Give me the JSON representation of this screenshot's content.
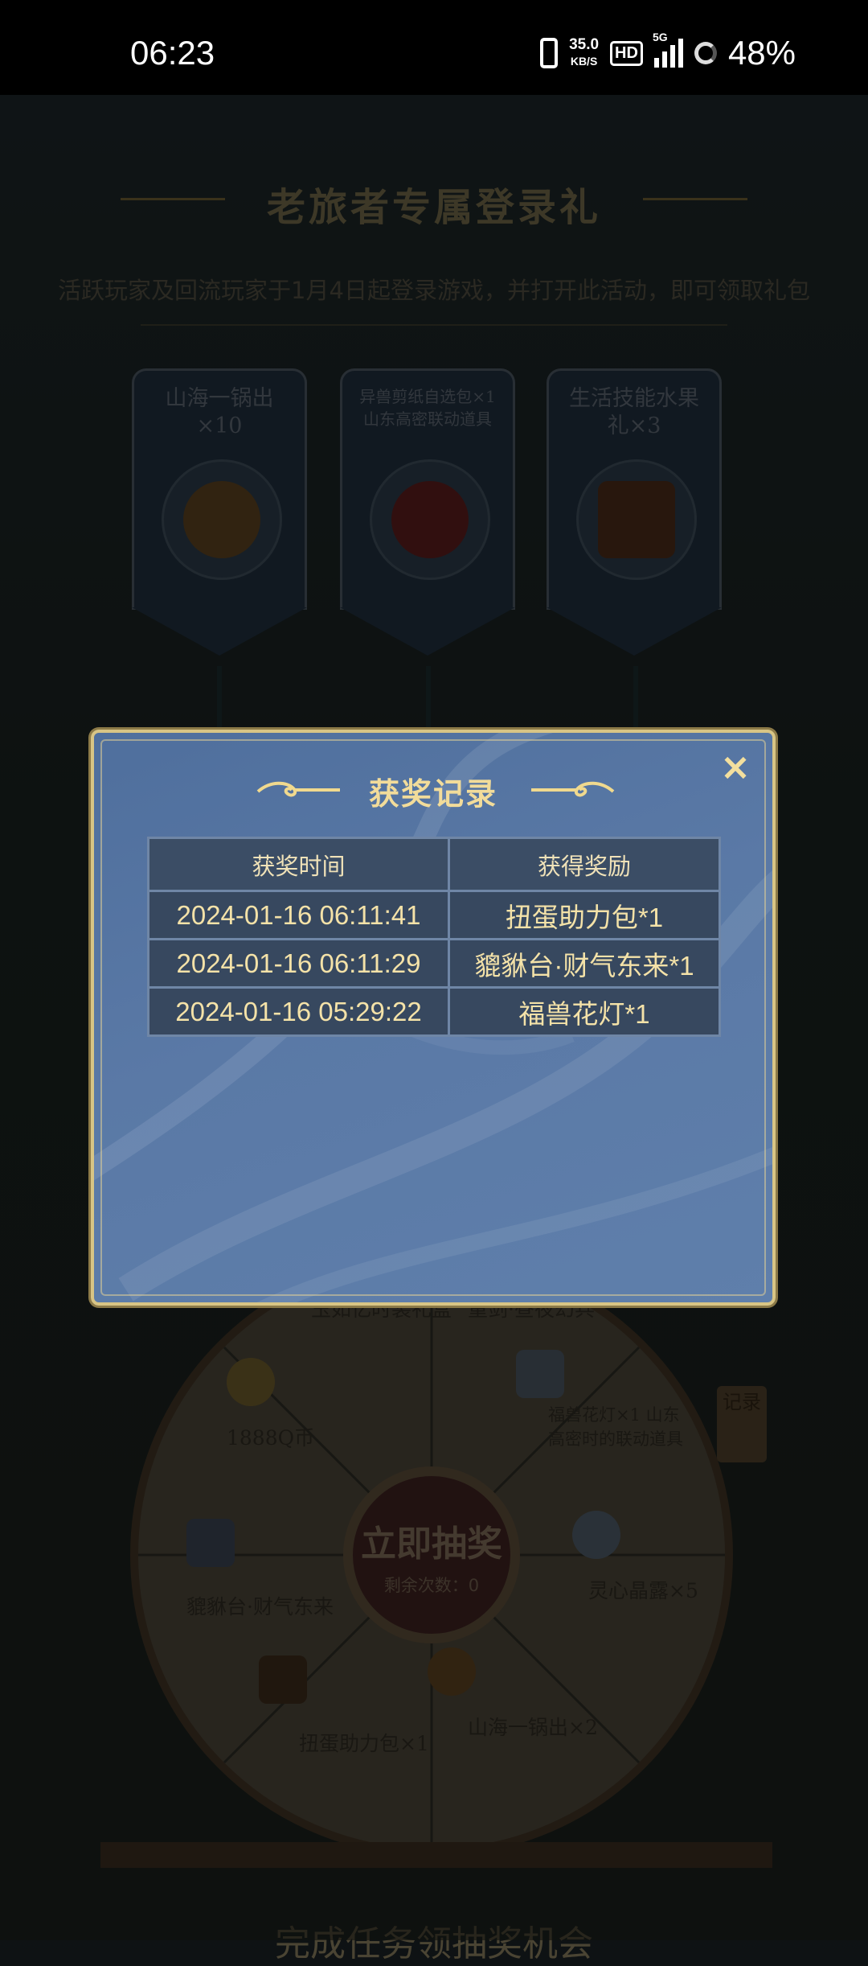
{
  "status_bar": {
    "time": "06:23",
    "speed_value": "35.0",
    "speed_unit": "KB/S",
    "hd": "HD",
    "network": "5G",
    "battery": "48%"
  },
  "background": {
    "title": "老旅者专属登录礼",
    "subtitle": "活跃玩家及回流玩家于1月4日起登录游戏，并打开此活动，即可领取礼包",
    "rewards": [
      {
        "label": "山海一锅出×10"
      },
      {
        "label_line1": "异兽剪纸自选包×1",
        "label_line2": "山东高密联动道具"
      },
      {
        "label": "生活技能水果礼×3"
      }
    ],
    "wheel": {
      "center_title": "立即抽奖",
      "center_sub": "剩余次数：0",
      "segments": [
        "玉如忆时装礼盒",
        "重剑·昼夜幻兵",
        "福兽花灯×1 山东高密时的联动道具",
        "灵心晶露×5",
        "山海一锅出×2",
        "扭蛋助力包×1",
        "貔貅台·财气东来",
        "1888Q币"
      ]
    },
    "record_tab": "记录",
    "bottom_title": "完成任务领抽奖机会"
  },
  "modal": {
    "title": "获奖记录",
    "close_label": "×",
    "columns": [
      "获奖时间",
      "获得奖励"
    ],
    "rows": [
      {
        "time": "2024-01-16 06:11:41",
        "reward": "扭蛋助力包*1"
      },
      {
        "time": "2024-01-16 06:11:29",
        "reward": "貔貅台·财气东来*1"
      },
      {
        "time": "2024-01-16 05:29:22",
        "reward": "福兽花灯*1"
      }
    ]
  },
  "colors": {
    "modal_bg": "#5a79a6",
    "modal_border": "#d8c585",
    "text_gold": "#f4e2a8"
  }
}
